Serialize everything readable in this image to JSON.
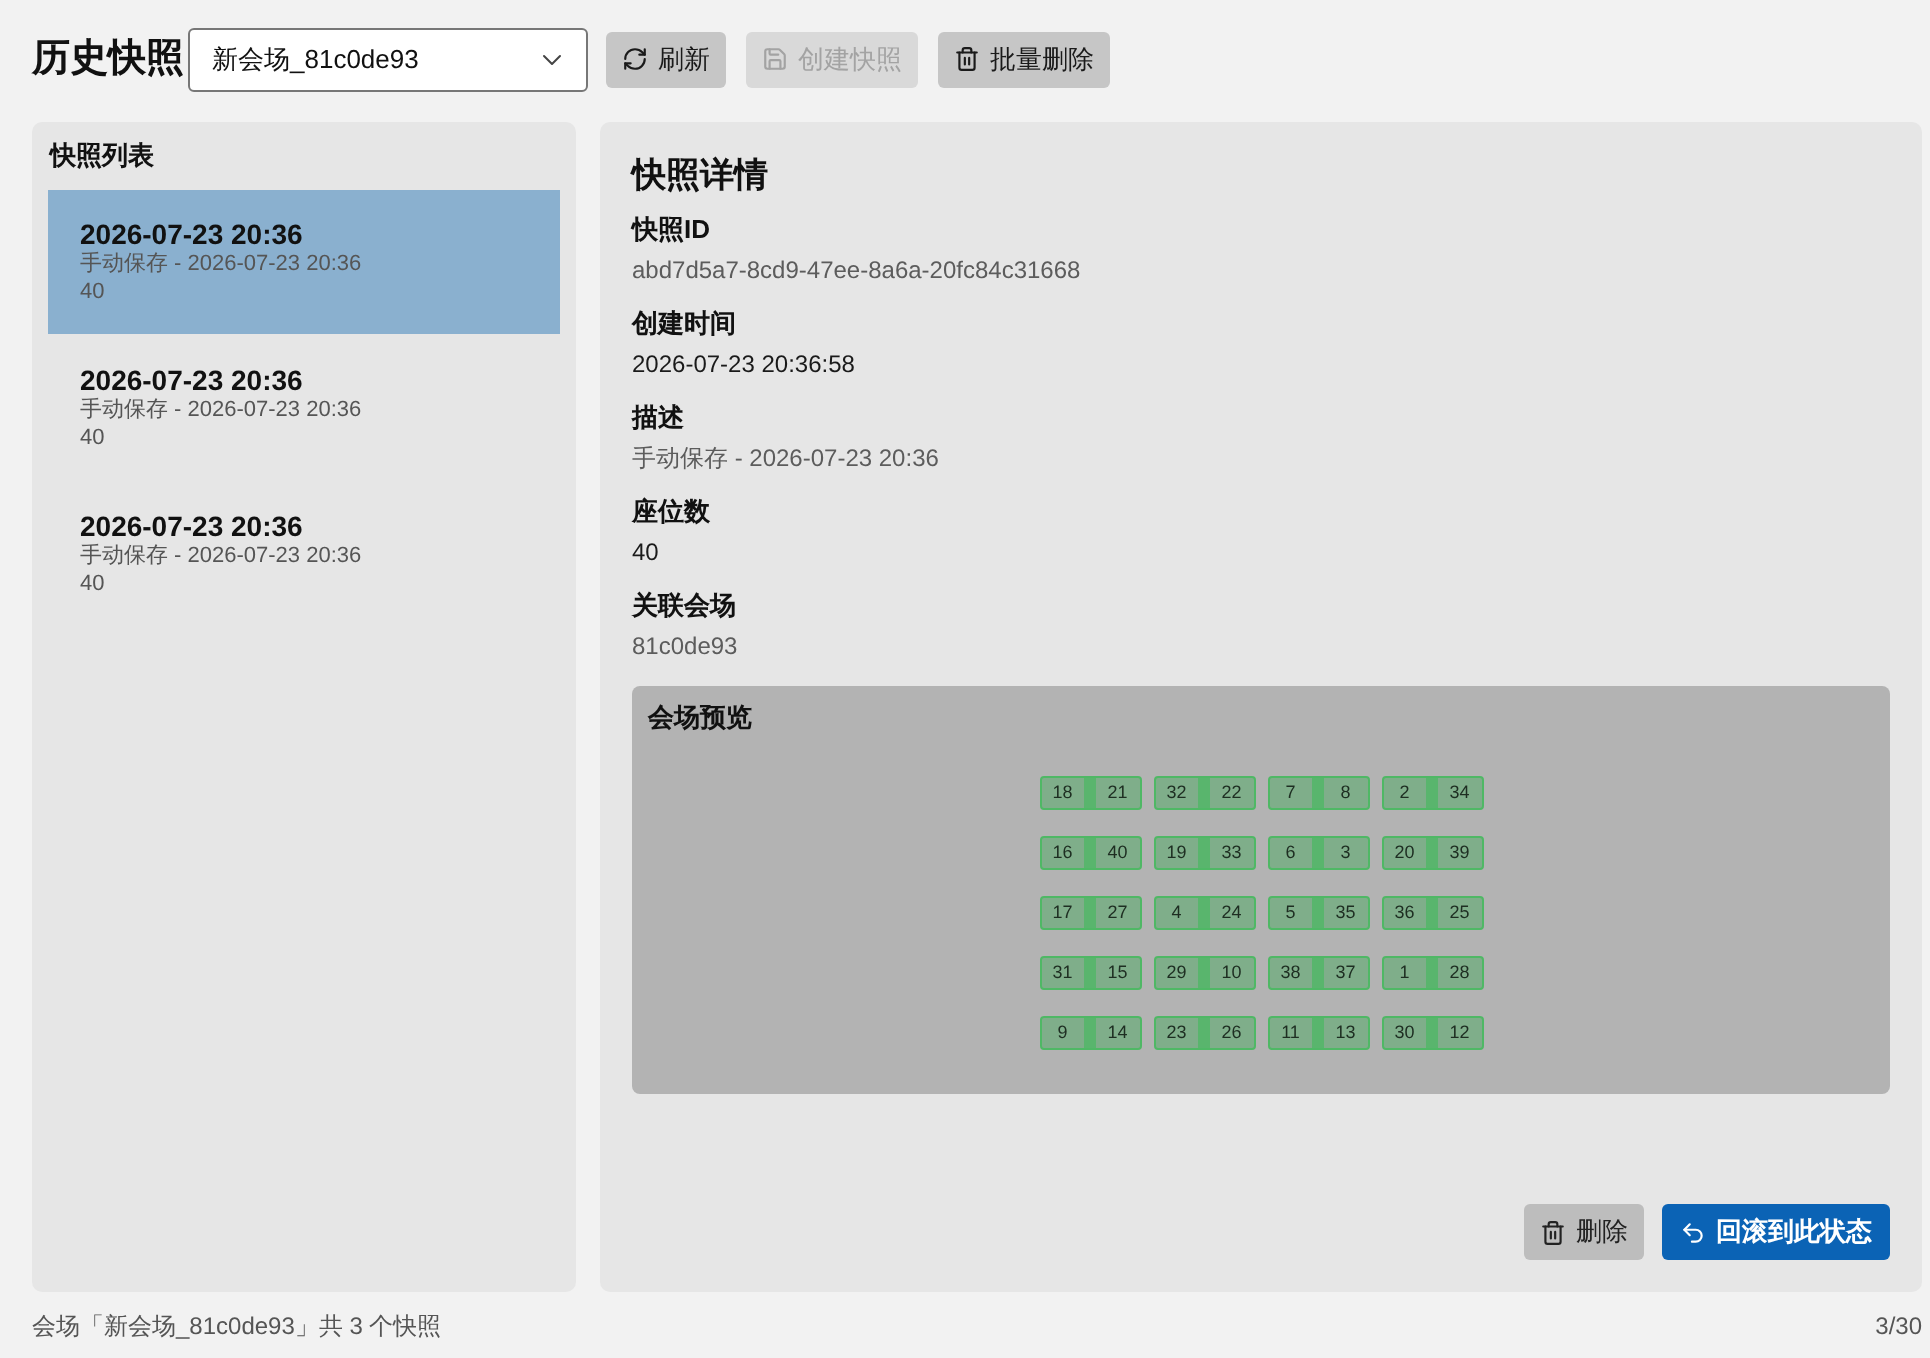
{
  "header": {
    "title": "历史快照",
    "venue_select": {
      "value": "新会场_81c0de93"
    },
    "buttons": [
      {
        "kind": "refresh",
        "label": "刷新",
        "disabled": false
      },
      {
        "kind": "save",
        "label": "创建快照",
        "disabled": true
      },
      {
        "kind": "delete",
        "label": "批量删除",
        "disabled": false
      }
    ]
  },
  "snapshot_list": {
    "title": "快照列表",
    "items": [
      {
        "title": "2026-07-23 20:36",
        "description": "手动保存 - 2026-07-23 20:36",
        "seats": "40",
        "selected": true
      },
      {
        "title": "2026-07-23 20:36",
        "description": "手动保存 - 2026-07-23 20:36",
        "seats": "40",
        "selected": false
      },
      {
        "title": "2026-07-23 20:36",
        "description": "手动保存 - 2026-07-23 20:36",
        "seats": "40",
        "selected": false
      }
    ]
  },
  "details": {
    "title": "快照详情",
    "fields": [
      {
        "label": "快照ID",
        "value": "abd7d5a7-8cd9-47ee-8a6a-20fc84c31668",
        "muted": true
      },
      {
        "label": "创建时间",
        "value": "2026-07-23 20:36:58",
        "muted": false
      },
      {
        "label": "描述",
        "value": "手动保存 - 2026-07-23 20:36",
        "muted": true
      },
      {
        "label": "座位数",
        "value": "40",
        "muted": false
      },
      {
        "label": "关联会场",
        "value": "81c0de93",
        "muted": true
      }
    ],
    "preview": {
      "title": "会场预览",
      "rows": [
        [
          {
            "seats": [
              "18",
              "21"
            ]
          },
          {
            "seats": [
              "32",
              "22"
            ]
          },
          {
            "seats": [
              "7",
              "8"
            ]
          },
          {
            "seats": [
              "2",
              "34"
            ]
          }
        ],
        [
          {
            "seats": [
              "16",
              "40"
            ]
          },
          {
            "seats": [
              "19",
              "33"
            ]
          },
          {
            "seats": [
              "6",
              "3"
            ]
          },
          {
            "seats": [
              "20",
              "39"
            ]
          }
        ],
        [
          {
            "seats": [
              "17",
              "27"
            ]
          },
          {
            "seats": [
              "4",
              "24"
            ]
          },
          {
            "seats": [
              "5",
              "35"
            ]
          },
          {
            "seats": [
              "36",
              "25"
            ]
          }
        ],
        [
          {
            "seats": [
              "31",
              "15"
            ]
          },
          {
            "seats": [
              "29",
              "10"
            ]
          },
          {
            "seats": [
              "38",
              "37"
            ]
          },
          {
            "seats": [
              "1",
              "28"
            ]
          }
        ],
        [
          {
            "seats": [
              "9",
              "14"
            ]
          },
          {
            "seats": [
              "23",
              "26"
            ]
          },
          {
            "seats": [
              "11",
              "13"
            ]
          },
          {
            "seats": [
              "30",
              "12"
            ]
          }
        ]
      ]
    },
    "actions": [
      {
        "kind": "delete",
        "label": "删除"
      },
      {
        "kind": "rollback",
        "label": "回滚到此状态"
      }
    ]
  },
  "status_bar": {
    "summary": "会场「新会场_81c0de93」共 3 个快照",
    "count": "3/30"
  }
}
